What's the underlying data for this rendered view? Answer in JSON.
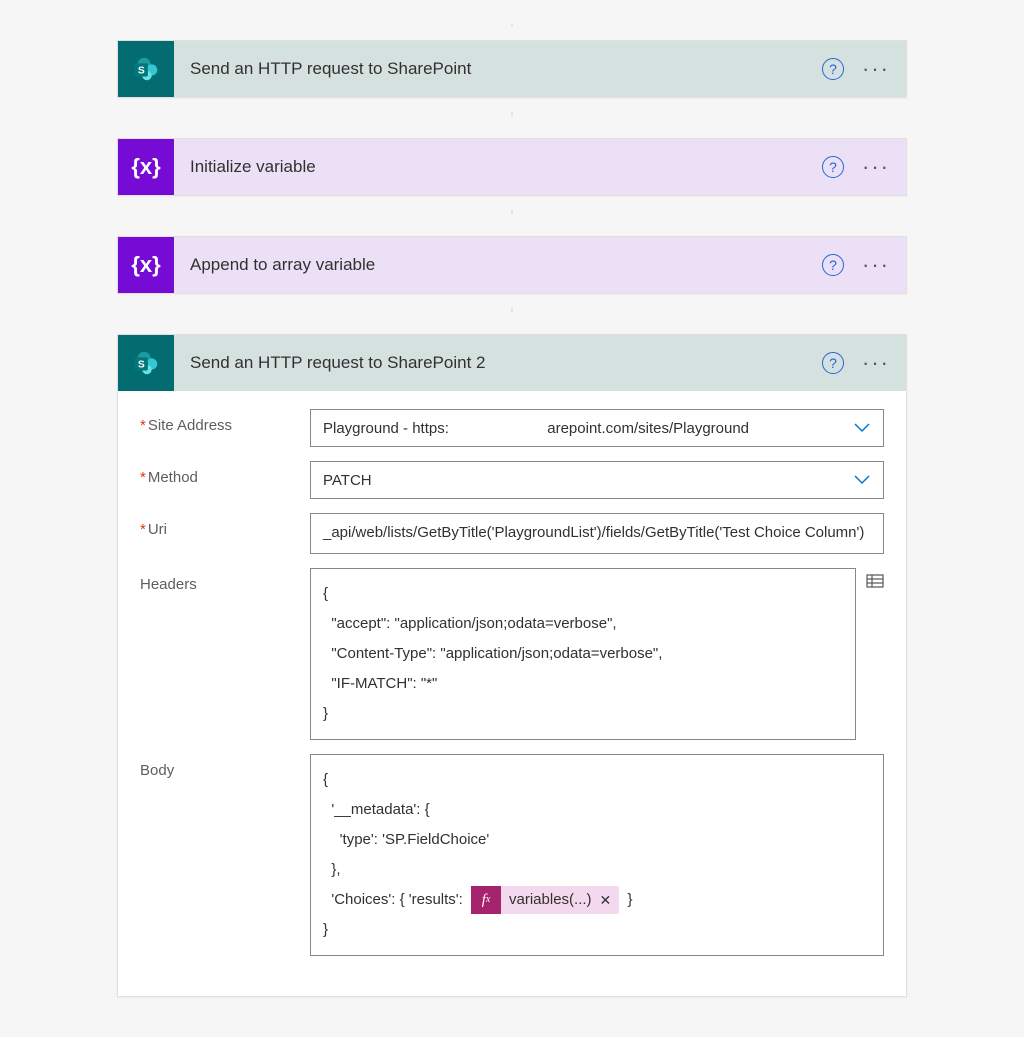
{
  "actions": [
    {
      "title": "Send an HTTP request to SharePoint",
      "type": "sharepoint"
    },
    {
      "title": "Initialize variable",
      "type": "variable"
    },
    {
      "title": "Append to array variable",
      "type": "variable"
    },
    {
      "title": "Send an HTTP request to SharePoint 2",
      "type": "sharepoint",
      "expanded": true
    }
  ],
  "form": {
    "site_address_label": "Site Address",
    "site_address_value_prefix": "Playground - https:",
    "site_address_value_suffix": "arepoint.com/sites/Playground",
    "method_label": "Method",
    "method_value": "PATCH",
    "uri_label": "Uri",
    "uri_value": "_api/web/lists/GetByTitle('PlaygroundList')/fields/GetByTitle('Test Choice Column')",
    "headers_label": "Headers",
    "headers_lines": [
      "{",
      "  \"accept\": \"application/json;odata=verbose\",",
      "  \"Content-Type\": \"application/json;odata=verbose\",",
      "  \"IF-MATCH\": \"*\"",
      "}"
    ],
    "body_label": "Body",
    "body_before_token": [
      "{",
      "  '__metadata': {",
      "    'type': 'SP.FieldChoice'",
      "  },",
      "  'Choices': { 'results': "
    ],
    "body_after_token": " }",
    "body_closing": "}",
    "token_label": "variables(...)"
  },
  "icons": {
    "variable_glyph": "{x}",
    "fx_glyph": "fx",
    "help_glyph": "?",
    "menu_glyph": "···",
    "close_glyph": "✕"
  }
}
